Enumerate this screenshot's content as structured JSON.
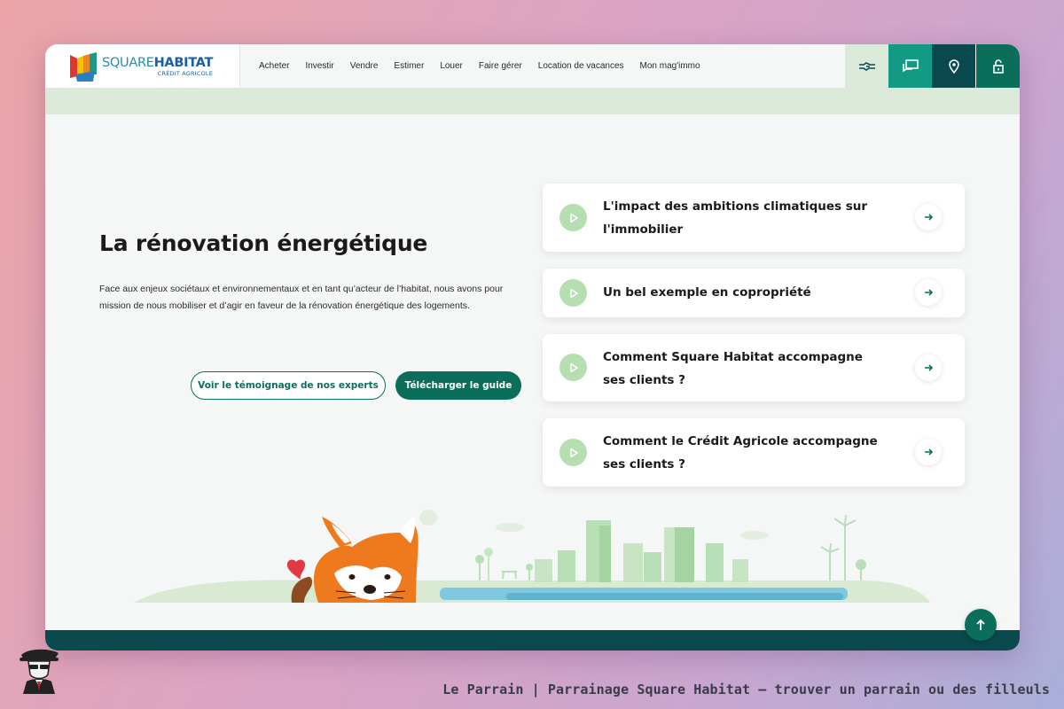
{
  "logo": {
    "name_light": "SQUARE",
    "name_bold": "HABITAT",
    "sub": "CRÉDIT AGRICOLE"
  },
  "nav": {
    "items": [
      "Acheter",
      "Investir",
      "Vendre",
      "Estimer",
      "Louer",
      "Faire gérer",
      "Location de vacances",
      "Mon mag'immo"
    ]
  },
  "header_buttons": [
    {
      "icon": "handshake-icon",
      "color": "#dbe9d8"
    },
    {
      "icon": "chat-icon",
      "color": "#129a84"
    },
    {
      "icon": "location-pin-icon",
      "color": "#0a4a4f"
    },
    {
      "icon": "lock-icon",
      "color": "#0b6e5a"
    }
  ],
  "hero": {
    "title": "La rénovation énergétique",
    "description": "Face aux enjeux sociétaux et environnementaux et en tant qu’acteur de l’habitat, nous avons pour mission de nous mobiliser et d’agir en faveur de la rénovation énergétique des logements.",
    "btn_experts": "Voir le témoignage de nos experts",
    "btn_guide": "Télécharger le guide"
  },
  "videos": [
    {
      "title": "L'impact des ambitions climatiques sur l'immobilier"
    },
    {
      "title": "Un bel exemple en copropriété"
    },
    {
      "title": "Comment Square Habitat accompagne ses clients ?"
    },
    {
      "title": "Comment le Crédit Agricole accompagne ses clients ?"
    }
  ],
  "caption": "Le Parrain | Parrainage Square Habitat — trouver un parrain ou des filleuls",
  "colors": {
    "brand_green": "#0b6e5a",
    "teal": "#129a84",
    "dark_teal": "#0a4a4f",
    "light_green": "#dbe9d8"
  }
}
